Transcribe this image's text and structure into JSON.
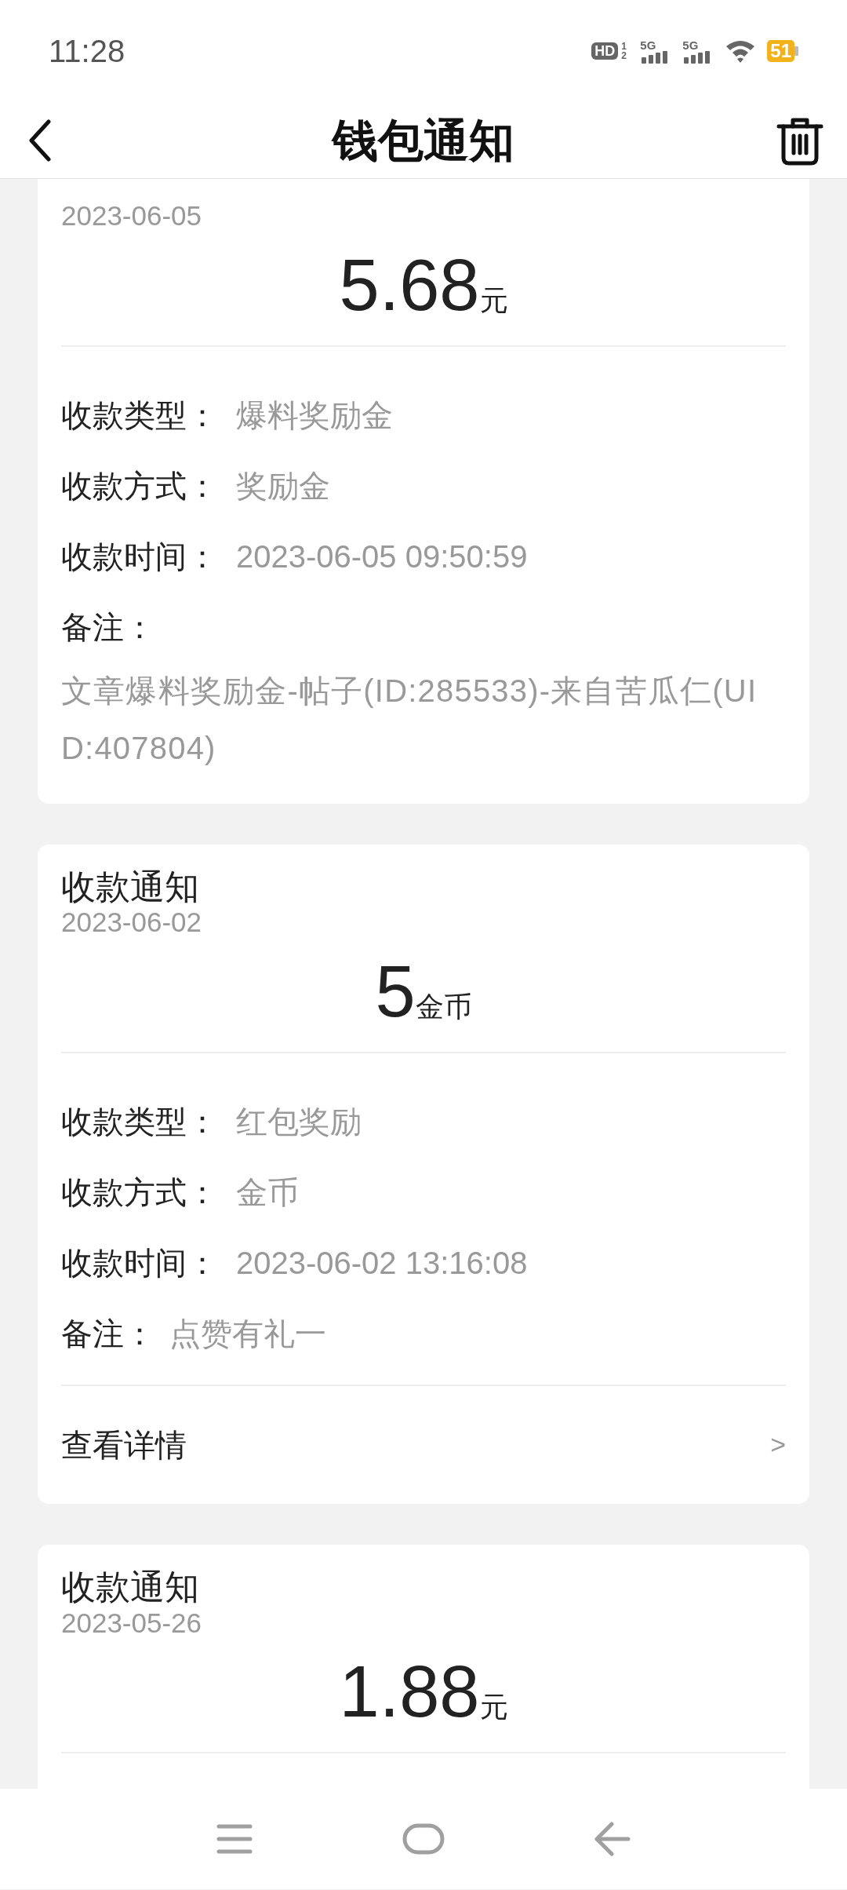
{
  "status_bar": {
    "time": "11:28",
    "hd": "HD",
    "hd_sub": "1 2",
    "networks": [
      "5G",
      "5G"
    ],
    "battery": "51"
  },
  "header": {
    "title": "钱包通知"
  },
  "notices": [
    {
      "date": "2023-06-05",
      "amount": "5.68",
      "unit": "元",
      "rows": [
        {
          "kind": "inline",
          "label": "收款类型：",
          "value": "爆料奖励金"
        },
        {
          "kind": "inline",
          "label": "收款方式：",
          "value": "奖励金"
        },
        {
          "kind": "inline",
          "label": "收款时间：",
          "value": "2023-06-05 09:50:59"
        },
        {
          "kind": "block",
          "label": "备注：",
          "value": "文章爆料奖励金-帖子(ID:285533)-来自苦瓜仁(UID:407804)"
        }
      ]
    },
    {
      "title": "收款通知",
      "date": "2023-06-02",
      "amount": "5",
      "unit": "金币",
      "rows": [
        {
          "kind": "inline",
          "label": "收款类型：",
          "value": "红包奖励"
        },
        {
          "kind": "inline",
          "label": "收款方式：",
          "value": "金币"
        },
        {
          "kind": "inline",
          "label": "收款时间：",
          "value": "2023-06-02 13:16:08"
        },
        {
          "kind": "compact",
          "label": "备注：",
          "value": "点赞有礼一"
        }
      ],
      "details_link": {
        "label": "查看详情",
        "chevron": ">"
      }
    },
    {
      "title": "收款通知",
      "date": "2023-05-26",
      "amount": "1.88",
      "unit": "元"
    }
  ]
}
